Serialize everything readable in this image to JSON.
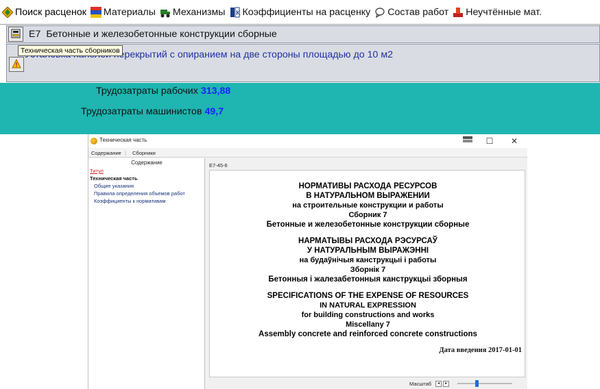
{
  "tabs": [
    {
      "label": "Поиск расценок",
      "icon": "search-arrows-icon",
      "active": true
    },
    {
      "label": "Материалы",
      "icon": "materials-icon"
    },
    {
      "label": "Механизмы",
      "icon": "machinery-icon"
    },
    {
      "label": "Коэффициенты на расценку",
      "icon": "coefficients-icon"
    },
    {
      "label": "Состав работ",
      "icon": "speech-bubble-icon"
    },
    {
      "label": "Неучтённые мат.",
      "icon": "unaccounted-materials-icon"
    }
  ],
  "collection": {
    "code": "Е7",
    "name": "Бетонные и железобетонные конструкции сборные",
    "tooltip": "Техническая часть сборников"
  },
  "rate": {
    "description": "Установка панелей перекрытий с опиранием на две стороны площадью до 10 м2"
  },
  "labour": {
    "workers_label": "Трудозатраты рабочих",
    "workers_value": "313,88",
    "operators_label": "Трудозатраты машинистов",
    "operators_value": "49,7",
    "background_color": "#1fb5b0",
    "value_color": "#1a22ff"
  },
  "help_window": {
    "title": "Техническая часть",
    "minimize": "—",
    "maximize": "☐",
    "close": "✕",
    "menu": [
      "Содержание",
      "Сборники"
    ],
    "toc_heading": "Содержание",
    "toc": [
      {
        "label": "Титул",
        "link": true
      },
      {
        "label": "Техническая часть",
        "bold": true
      },
      {
        "label": "Общие указания"
      },
      {
        "label": "Правила определения объемов работ"
      },
      {
        "label": "Коэффициенты к нормативам"
      }
    ],
    "doc_id": "Е7-45-6",
    "doc_lines": [
      "НОРМАТИВЫ РАСХОДА РЕСУРСОВ",
      "В НАТУРАЛЬНОМ ВЫРАЖЕНИИ",
      "на строительные конструкции и работы",
      "Сборник 7",
      "Бетонные и железобетонные конструкции сборные",
      "НАРМАТЫВЫ РАСХОДА РЭСУРСАЎ",
      "У НАТУРАЛЬНЫМ ВЫРАЖЭННІ",
      "на будаўнічыя канструкцыі і работы",
      "Зборнік 7",
      "Бетонныя і жалезабетонныя канструкцыі зборныя",
      "SPECIFICATIONS OF THE EXPENSE OF RESOURCES",
      "IN NATURAL EXPRESSION",
      "for building constructions and works",
      "Miscellany 7",
      "Assembly concrete and reinforced concrete constructions"
    ],
    "doc_date": "Дата введения 2017-01-01",
    "zoom_label": "Масштаб",
    "zoom_level": 0.35
  }
}
